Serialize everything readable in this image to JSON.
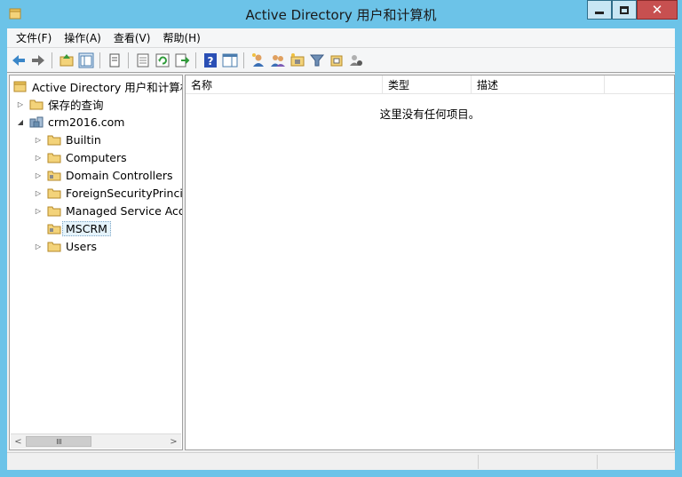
{
  "window": {
    "title": "Active Directory 用户和计算机",
    "app_icon": "ad-folder-icon"
  },
  "menubar": {
    "items": [
      {
        "label": "文件(F)"
      },
      {
        "label": "操作(A)"
      },
      {
        "label": "查看(V)"
      },
      {
        "label": "帮助(H)"
      }
    ]
  },
  "toolbar": {
    "buttons": [
      "back-arrow-icon",
      "forward-arrow-icon",
      "up-folder-icon",
      "show-console-tree-icon",
      "copy-icon",
      "properties-icon",
      "refresh-icon",
      "export-list-icon",
      "help-icon",
      "show-action-pane-icon",
      "new-user-icon",
      "new-group-icon",
      "new-ou-icon",
      "filter-icon",
      "add-to-group-icon",
      "delegate-control-icon"
    ]
  },
  "tree": {
    "root": {
      "label": "Active Directory 用户和计算机"
    },
    "saved_queries": {
      "label": "保存的查询"
    },
    "domain": {
      "label": "crm2016.com"
    },
    "children": [
      {
        "label": "Builtin"
      },
      {
        "label": "Computers"
      },
      {
        "label": "Domain Controllers"
      },
      {
        "label": "ForeignSecurityPrincipa"
      },
      {
        "label": "Managed Service Acco"
      },
      {
        "label": "MSCRM"
      },
      {
        "label": "Users"
      }
    ],
    "selected": "MSCRM"
  },
  "list": {
    "columns": [
      {
        "label": "名称"
      },
      {
        "label": "类型"
      },
      {
        "label": "描述"
      }
    ],
    "empty_message": "这里没有任何项目。"
  },
  "colors": {
    "title_bar": "#6cc3e8",
    "close_button": "#c75050",
    "folder": "#f3d37a"
  }
}
